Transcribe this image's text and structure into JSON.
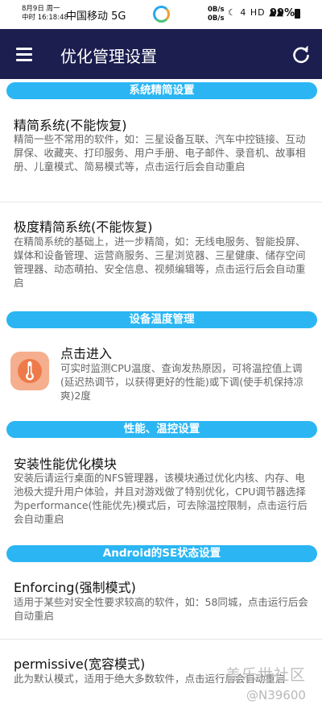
{
  "status_bar": {
    "date": "8月9日 周一",
    "time": "中国移动 16:18:48",
    "time_label": "16:18:48",
    "carrier": "中国移动 5G",
    "speed_up": "0B/s",
    "speed_down": "0B/s",
    "icons": "☾ 4 HD ▲▲",
    "battery": "99%"
  },
  "app_bar": {
    "title": "优化管理设置",
    "menu_icon": "menu-icon",
    "refresh_icon": "refresh-icon"
  },
  "sections": [
    {
      "header": "系统精简设置",
      "items": [
        {
          "title": "精简系统(不能恢复)",
          "desc": "精简一些不常用的软件，如：三星设备互联、汽车中控链接、互动屏保、收藏夹、打印服务、用户手册、电子邮件、录音机、故事相册、儿童模式、简易模式等，点击运行后会自动重启"
        },
        {
          "title": "极度精简系统(不能恢复)",
          "desc": "在精简系统的基础上，进一步精简，如：无线电服务、智能投屏、媒体和设备管理、运营商服务、三星浏览器、三星健康、储存空间管理器、动态萌拍、安全信息、视频编辑等，点击运行后会自动重启"
        }
      ]
    },
    {
      "header": "设备温度管理",
      "items": [
        {
          "title": "点击进入",
          "desc": "可实时监测CPU温度、查询发热原因，可将温控值上调(延迟热调节，以获得更好的性能)或下调(使手机保持凉爽)2度",
          "icon": "thermometer-icon"
        }
      ]
    },
    {
      "header": "性能、温控设置",
      "items": [
        {
          "title": "安装性能优化模块",
          "desc": "安装后请运行桌面的NFS管理器，该模块通过优化内核、内存、电池极大提升用户体验，并且对游戏做了特别优化，CPU调节器选择为performance(性能优先)模式后，可去除温控限制，点击运行后会自动重启"
        }
      ]
    },
    {
      "header": "Android的SE状态设置",
      "items": [
        {
          "title": "Enforcing(强制模式)",
          "desc": "适用于某些对安全性要求较高的软件，如：58同城，点击运行后会自动重启"
        },
        {
          "title": "permissive(宽容模式)",
          "desc": "此为默认模式，适用于绝大多数软件，点击运行后会自动重启"
        }
      ]
    }
  ],
  "watermark": {
    "brand": "盖乐世社区",
    "user": "@N39600"
  },
  "colors": {
    "app_bar": "#1b1e4e",
    "section_header": "#2bb6f3",
    "thermo_bg": "#f5ae8e",
    "thermo_fg": "#ee7a4a"
  }
}
